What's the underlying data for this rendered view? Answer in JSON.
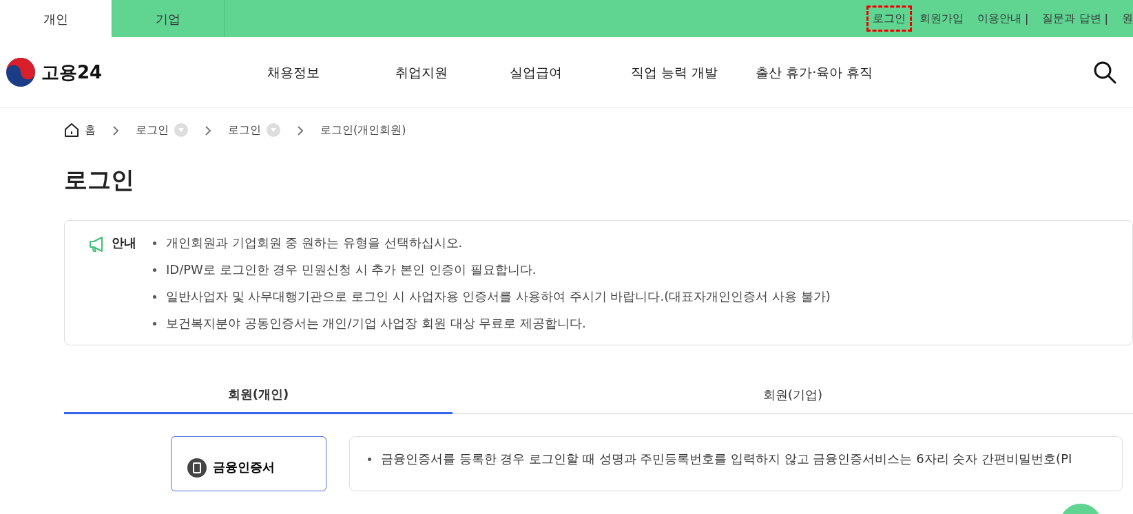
{
  "user_tabs": [
    {
      "label": "개인",
      "selected": true
    },
    {
      "label": "기업",
      "selected": false
    }
  ],
  "util_links": [
    {
      "label": "로그인",
      "focused": true
    },
    {
      "label": "회원가입",
      "focused": false
    },
    {
      "label": "이용안내 |",
      "focused": false
    },
    {
      "label": "질문과 답변 |",
      "focused": false
    },
    {
      "label": "원",
      "focused": false
    }
  ],
  "logo": {
    "text": "고용24"
  },
  "main_nav": [
    "채용정보",
    "취업지원",
    "실업급여",
    "직업 능력 개발",
    "출산 휴가·육아 휴직"
  ],
  "breadcrumb": [
    {
      "label": "홈",
      "kind": "home"
    },
    {
      "label": "로그인",
      "kind": "dropdown"
    },
    {
      "label": "로그인",
      "kind": "dropdown"
    },
    {
      "label": "로그인(개인회원)",
      "kind": "current"
    }
  ],
  "page_title": "로그인",
  "notice": {
    "label": "안내",
    "items": [
      "개인회원과 기업회원 중 원하는 유형을 선택하십시오.",
      "ID/PW로 로그인한 경우 민원신청 시 추가 본인 인증이 필요합니다.",
      "일반사업자 및 사무대행기관으로 로그인 시 사업자용 인증서를 사용하여 주시기 바랍니다.(대표자개인인증서 사용 불가)",
      "보건복지분야 공동인증서는 개인/기업 사업장 회원 대상 무료로 제공합니다."
    ]
  },
  "member_tabs": [
    {
      "label": "회원(개인)",
      "selected": true
    },
    {
      "label": "회원(기업)",
      "selected": false
    }
  ],
  "login_methods": [
    {
      "label": "금융인증서",
      "selected": true
    }
  ],
  "method_info": [
    "금융인증서를 등록한 경우 로그인할 때 성명과 주민등록번호를 입력하지 않고 금융인증서비스는 6자리 숫자 간편비밀번호(PI"
  ]
}
